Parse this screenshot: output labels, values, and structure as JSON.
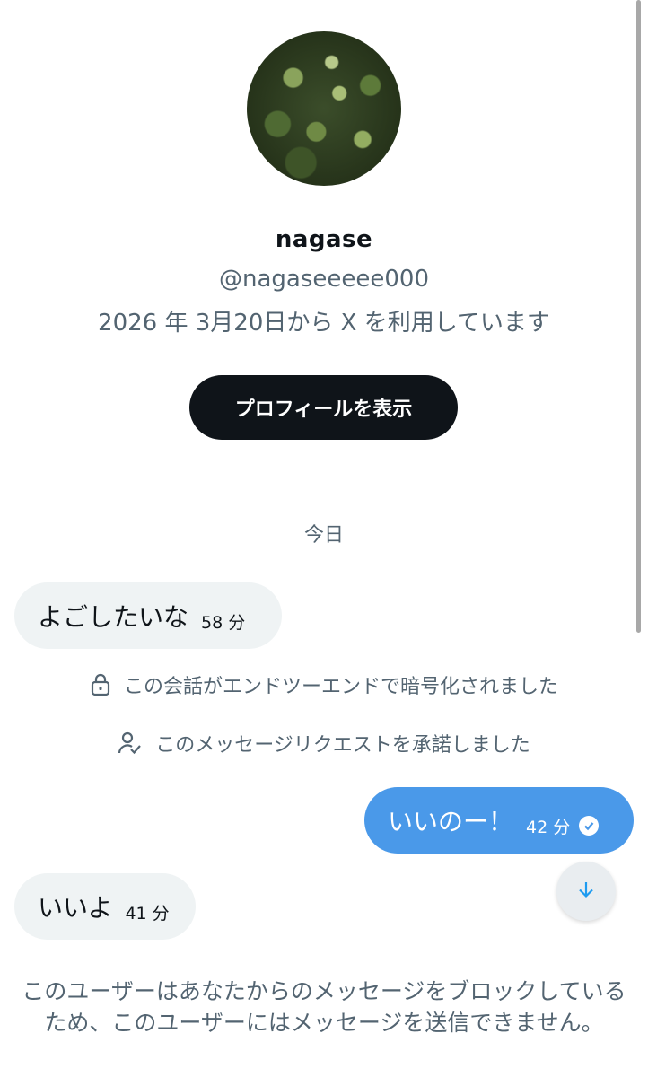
{
  "profile": {
    "display_name": "nagase",
    "handle": "@nagaseeeee000",
    "joined": "2026 年 3月20日から X を利用しています",
    "view_profile_button": "プロフィールを表示"
  },
  "date_separator": "今日",
  "messages": [
    {
      "direction": "incoming",
      "text": "よごしたいな",
      "time": "58 分"
    },
    {
      "direction": "outgoing",
      "text": "いいのー！",
      "time": "42 分",
      "status_icon": "read-check-icon"
    },
    {
      "direction": "incoming",
      "text": "いいよ",
      "time": "41 分"
    }
  ],
  "system_messages": [
    {
      "icon": "lock-icon",
      "text": "この会話がエンドツーエンドで暗号化されました"
    },
    {
      "icon": "user-check-icon",
      "text": "このメッセージリクエストを承諾しました"
    }
  ],
  "blocked_notice": "このユーザーはあなたからのメッセージをブロックしているため、このユーザーにはメッセージを送信できません。",
  "colors": {
    "outgoing_bubble": "#4a99e9",
    "incoming_bubble": "#eff3f4",
    "button": "#0f1419",
    "muted_text": "#536471"
  }
}
